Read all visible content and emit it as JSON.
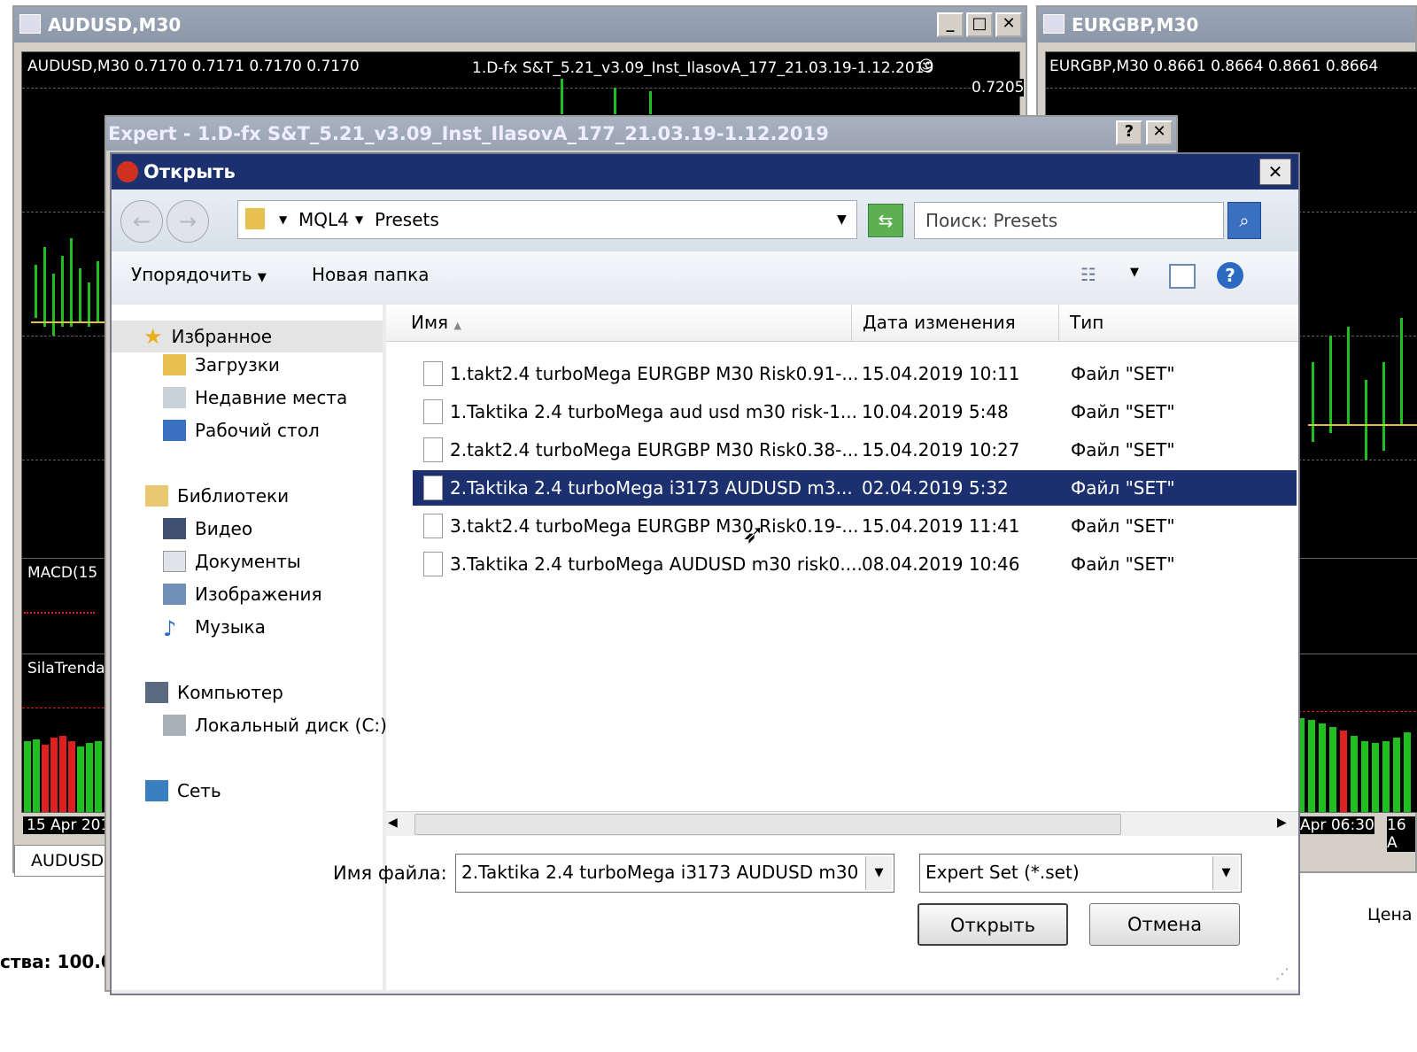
{
  "charts": {
    "left": {
      "title": "AUDUSD,M30",
      "info": "AUDUSD,M30  0.7170 0.7171 0.7170 0.7170",
      "ea_label": "1.D-fx S&T_5.21_v3.09_Inst_IlasovA_177_21.03.19-1.12.2019",
      "price": "0.7205",
      "macd": "MACD(15",
      "sila": "SilaTrenda",
      "date": "15 Apr 2019",
      "tab": "AUDUSD"
    },
    "right": {
      "title": "EURGBP,M30",
      "info": "EURGBP,M30  0.8661 0.8664 0.8661 0.8664",
      "time1": "Apr 06:30",
      "time2": "16 A",
      "price_col": "Цена"
    },
    "status": "ства: 100.0"
  },
  "expert": {
    "title": "Expert - 1.D-fx S&T_5.21_v3.09_Inst_IlasovA_177_21.03.19-1.12.2019",
    "help_btn": "?",
    "close_btn": "✕"
  },
  "dialog": {
    "title": "Открыть",
    "close_btn": "✕",
    "breadcrumb": [
      "MQL4",
      "Presets"
    ],
    "search_placeholder": "Поиск: Presets",
    "toolbar": {
      "organize": "Упорядочить",
      "new_folder": "Новая папка"
    },
    "nav": {
      "favorites": "Избранное",
      "fav_items": [
        "Загрузки",
        "Недавние места",
        "Рабочий стол"
      ],
      "libraries": "Библиотеки",
      "lib_items": [
        "Видео",
        "Документы",
        "Изображения",
        "Музыка"
      ],
      "computer": "Компьютер",
      "comp_items": [
        "Локальный диск (C:)"
      ],
      "network": "Сеть"
    },
    "columns": {
      "name": "Имя",
      "date": "Дата изменения",
      "type": "Тип"
    },
    "files": [
      {
        "name": "1.takt2.4 turboMega EURGBP M30 Risk0.91-...",
        "date": "15.04.2019 10:11",
        "type": "Файл \"SET\""
      },
      {
        "name": "1.Taktika 2.4 turboMega aud usd m30 risk-1...",
        "date": "10.04.2019 5:48",
        "type": "Файл \"SET\""
      },
      {
        "name": "2.takt2.4 turboMega EURGBP M30 Risk0.38-...",
        "date": "15.04.2019 10:27",
        "type": "Файл \"SET\""
      },
      {
        "name": "2.Taktika 2.4 turboMega  i3173 AUDUSD m3...",
        "date": "02.04.2019 5:32",
        "type": "Файл \"SET\""
      },
      {
        "name": "3.takt2.4 turboMega EURGBP M30 Risk0.19-...",
        "date": "15.04.2019 11:41",
        "type": "Файл \"SET\""
      },
      {
        "name": "3.Taktika 2.4 turboMega AUDUSD m30 risk0....",
        "date": "08.04.2019 10:46",
        "type": "Файл \"SET\""
      }
    ],
    "selected_index": 3,
    "filename_label": "Имя файла:",
    "filename_value": "2.Taktika 2.4 turboMega  i3173 AUDUSD m30",
    "filetype_value": "Expert Set (*.set)",
    "open_btn": "Открыть",
    "cancel_btn": "Отмена"
  },
  "colors": {
    "title_blue": "#1c2f6e",
    "chart_bg": "#000000",
    "bull": "#1fbf1f",
    "bear": "#e02020"
  }
}
